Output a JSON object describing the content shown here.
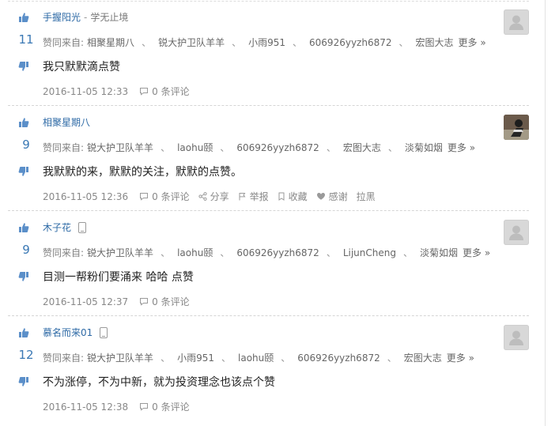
{
  "posts": [
    {
      "author": "手握阳光",
      "title_sep": "-",
      "author_title": "学无止境",
      "has_phone": false,
      "vote_count": "11",
      "likers_prefix": "赞同来自:",
      "likers": [
        "相聚星期八",
        "锐大护卫队羊羊",
        "小雨951",
        "606926yyzh6872",
        "宏图大志"
      ],
      "more": "更多 »",
      "content": "我只默默滴点赞",
      "time": "2016-11-05 12:33",
      "comments": "0 条评论",
      "actions": [],
      "avatar": "default"
    },
    {
      "author": "相聚星期八",
      "title_sep": "",
      "author_title": "",
      "has_phone": false,
      "vote_count": "9",
      "likers_prefix": "赞同来自:",
      "likers": [
        "锐大护卫队羊羊",
        "laohu颐",
        "606926yyzh6872",
        "宏图大志",
        "淡菊如烟"
      ],
      "more": "更多 »",
      "content": "我默默的来，默默的关注，默默的点赞。",
      "time": "2016-11-05 12:36",
      "comments": "0 条评论",
      "actions": [
        "分享",
        "举报",
        "收藏",
        "感谢",
        "拉黑"
      ],
      "avatar": "photo"
    },
    {
      "author": "木子花",
      "title_sep": "",
      "author_title": "",
      "has_phone": true,
      "vote_count": "9",
      "likers_prefix": "赞同来自:",
      "likers": [
        "锐大护卫队羊羊",
        "laohu颐",
        "606926yyzh6872",
        "LijunCheng",
        "淡菊如烟"
      ],
      "more": "更多 »",
      "content": "目测一帮粉们要涌来 哈哈 点赞",
      "time": "2016-11-05 12:37",
      "comments": "0 条评论",
      "actions": [],
      "avatar": "default"
    },
    {
      "author": "慕名而来01",
      "title_sep": "",
      "author_title": "",
      "has_phone": true,
      "vote_count": "12",
      "likers_prefix": "赞同来自:",
      "likers": [
        "锐大护卫队羊羊",
        "小雨951",
        "laohu颐",
        "606926yyzh6872",
        "宏图大志"
      ],
      "more": "更多 »",
      "content": "不为涨停，不为中新，就为投资理念也该点个赞",
      "time": "2016-11-05 12:38",
      "comments": "0 条评论",
      "actions": [],
      "avatar": "default"
    }
  ],
  "colors": {
    "link": "#2e6aa6",
    "vote_count": "#3a78b4",
    "vote_icon": "#5b8fc9",
    "muted": "#888888"
  },
  "icons": {
    "vote_up": "thumbs-up-icon",
    "vote_down": "thumbs-down-icon",
    "comment": "speech-bubble-icon",
    "share": "share-icon",
    "report": "flag-icon",
    "favorite": "bookmark-icon",
    "thanks": "heart-icon",
    "phone": "phone-icon",
    "avatar_default": "user-silhouette-icon"
  }
}
